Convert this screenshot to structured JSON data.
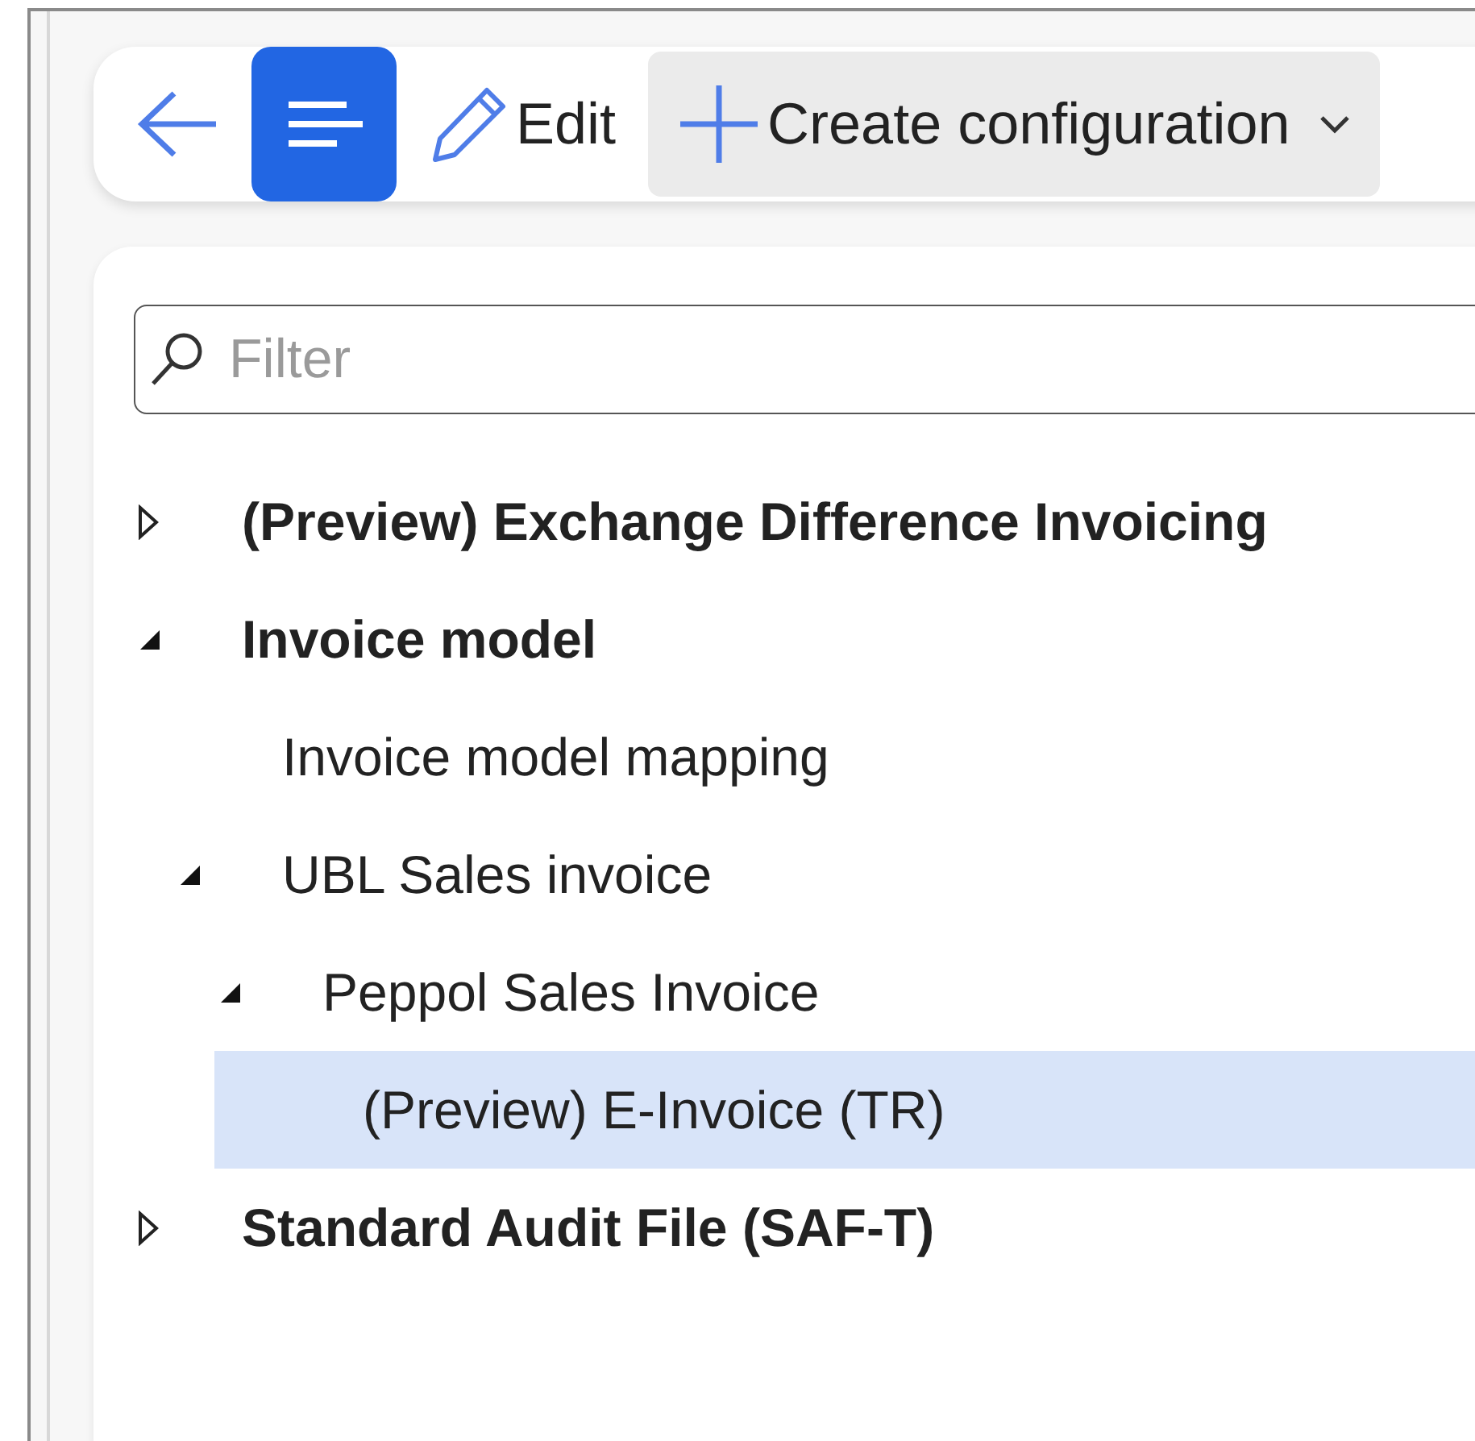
{
  "toolbar": [
    {
      "kind": "back",
      "selected": false
    },
    {
      "kind": "list",
      "selected": true
    },
    {
      "kind": "edit",
      "label": "Edit",
      "selected": false
    },
    {
      "kind": "create",
      "label": "Create configuration",
      "selected": false
    }
  ],
  "filter": {
    "placeholder": "Filter"
  },
  "tree": [
    {
      "label": "(Preview) Exchange Difference Invoicing",
      "expanded": false,
      "selected": false
    },
    {
      "label": "Invoice model",
      "expanded": true,
      "selected": false,
      "children": [
        {
          "label": "Invoice model mapping",
          "selected": false
        },
        {
          "label": "UBL Sales invoice",
          "expanded": true,
          "selected": false,
          "children": [
            {
              "label": "Peppol Sales Invoice",
              "expanded": true,
              "selected": false,
              "children": [
                {
                  "label": "(Preview) E-Invoice (TR)",
                  "selected": true
                }
              ]
            }
          ]
        }
      ]
    },
    {
      "label": "Standard Audit File (SAF-T)",
      "expanded": false,
      "selected": false
    }
  ]
}
